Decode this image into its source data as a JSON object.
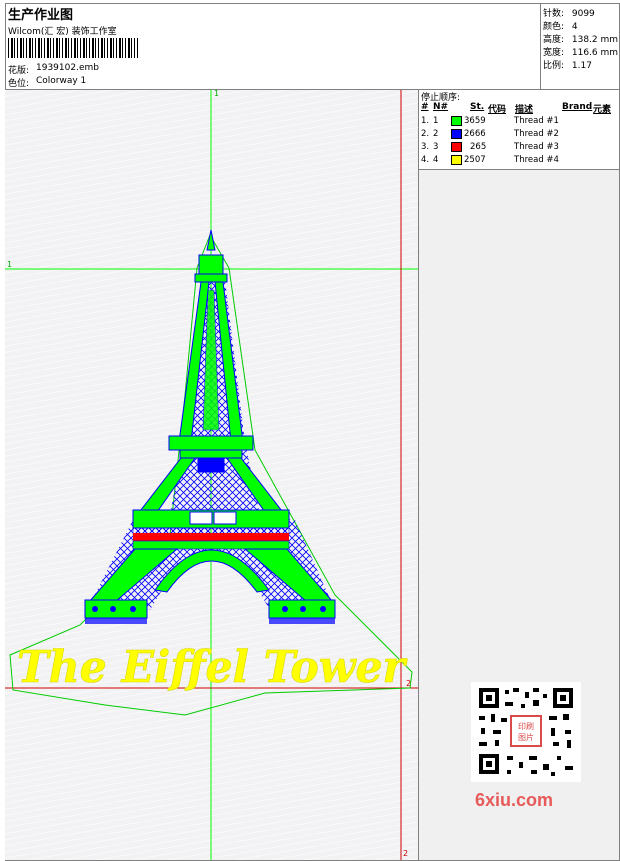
{
  "header": {
    "title": "生产作业图",
    "company": "Wilcom(汇 宏) 装饰工作室",
    "design_label": "花版:",
    "design_value": "1939102.emb",
    "colorway_label": "色位:",
    "colorway_value": "Colorway 1"
  },
  "stats": [
    {
      "label": "针数:",
      "value": "9099"
    },
    {
      "label": "颜色:",
      "value": "4"
    },
    {
      "label": "高度:",
      "value": "138.2 mm"
    },
    {
      "label": "宽度:",
      "value": "116.6 mm"
    },
    {
      "label": "比例:",
      "value": "1.17"
    }
  ],
  "stop_sequence": {
    "title": "停止顺序:",
    "headers": {
      "num": "#",
      "n": "N#",
      "st": "St.",
      "code": "代码",
      "desc": "描述",
      "brand": "Brand",
      "element": "元素"
    },
    "rows": [
      {
        "num": "1.",
        "n": "1",
        "color": "#00ff00",
        "st": "3659",
        "desc": "Thread #1"
      },
      {
        "num": "2.",
        "n": "2",
        "color": "#0000ff",
        "st": "2666",
        "desc": "Thread #2"
      },
      {
        "num": "3.",
        "n": "3",
        "color": "#ff0000",
        "st": "265",
        "desc": "Thread #3"
      },
      {
        "num": "4.",
        "n": "4",
        "color": "#ffff00",
        "st": "2507",
        "desc": "Thread #4"
      }
    ]
  },
  "canvas": {
    "guide_labels": {
      "top": "1",
      "left": "1",
      "right": "2",
      "bottom": "2"
    },
    "design_text": "The Eiffel Tower",
    "colors": {
      "green": "#00ff00",
      "blue": "#0000ff",
      "red": "#ff0000",
      "yellow": "#ffff00",
      "guide_green": "#00ff00",
      "guide_red": "#cc0000"
    }
  },
  "watermark": {
    "site": "6xiu.com",
    "seal_text": "印刷图片"
  }
}
